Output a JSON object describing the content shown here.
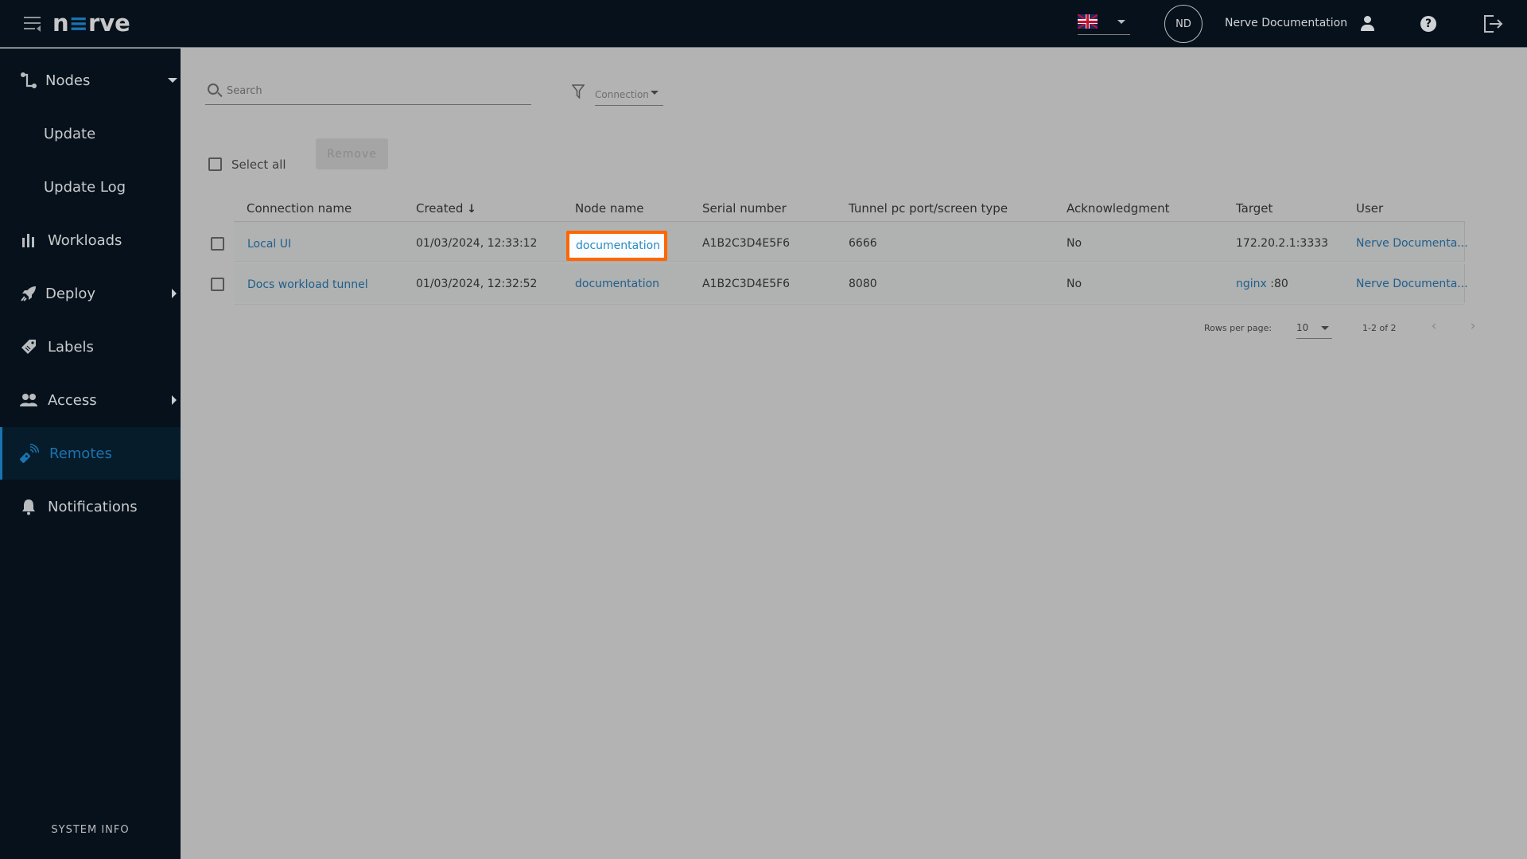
{
  "header": {
    "logo_text_pre": "n",
    "logo_text_accent": "≡",
    "logo_text_post": "rve",
    "language": "English (UK)",
    "avatar_initials": "ND",
    "username": "Nerve Documentation",
    "help_glyph": "?"
  },
  "sidebar": {
    "items": [
      {
        "label": "Nodes",
        "icon": "nodes-icon",
        "expanded": true
      },
      {
        "label": "Update"
      },
      {
        "label": "Update Log"
      },
      {
        "label": "Workloads",
        "icon": "workloads-icon"
      },
      {
        "label": "Deploy",
        "icon": "rocket-icon"
      },
      {
        "label": "Labels",
        "icon": "tag-icon"
      },
      {
        "label": "Access",
        "icon": "users-icon"
      },
      {
        "label": "Remotes",
        "icon": "remote-icon",
        "active": true
      },
      {
        "label": "Notifications",
        "icon": "bell-icon"
      }
    ],
    "system_info": "SYSTEM INFO"
  },
  "toolbar": {
    "search_placeholder": "Search",
    "filter_label": "Connection",
    "select_all_label": "Select all",
    "remove_label": "Remove"
  },
  "table": {
    "columns": [
      "Connection name",
      "Created",
      "Node name",
      "Serial number",
      "Tunnel pc port/screen type",
      "Acknowledgment",
      "Target",
      "User"
    ],
    "sort_column": "Created",
    "sort_direction": "descending",
    "sort_glyph": "↓",
    "rows": [
      {
        "connection_name": "Local UI",
        "created": "01/03/2024, 12:33:12",
        "node_name": "documentation",
        "serial_number": "A1B2C3D4E5F6",
        "port": "6666",
        "acknowledgment": "No",
        "target": "172.20.2.1:3333",
        "target_link": "",
        "target_suffix": "",
        "user": "Nerve Documenta..."
      },
      {
        "connection_name": "Docs workload tunnel",
        "created": "01/03/2024, 12:32:52",
        "node_name": "documentation",
        "serial_number": "A1B2C3D4E5F6",
        "port": "8080",
        "acknowledgment": "No",
        "target": "",
        "target_link": "nginx",
        "target_suffix": " :80",
        "user": "Nerve Documenta..."
      }
    ]
  },
  "pagination": {
    "rows_per_page_label": "Rows per page:",
    "rows_per_page": "10",
    "range": "1-2 of 2",
    "prev_glyph": "‹",
    "next_glyph": "›"
  },
  "colors": {
    "accent": "#1a74b0",
    "header_bg": "#06111b",
    "highlight_border": "#ff6600",
    "link": "#1f5f8c",
    "overlay_bg": "#b3b3b3"
  }
}
